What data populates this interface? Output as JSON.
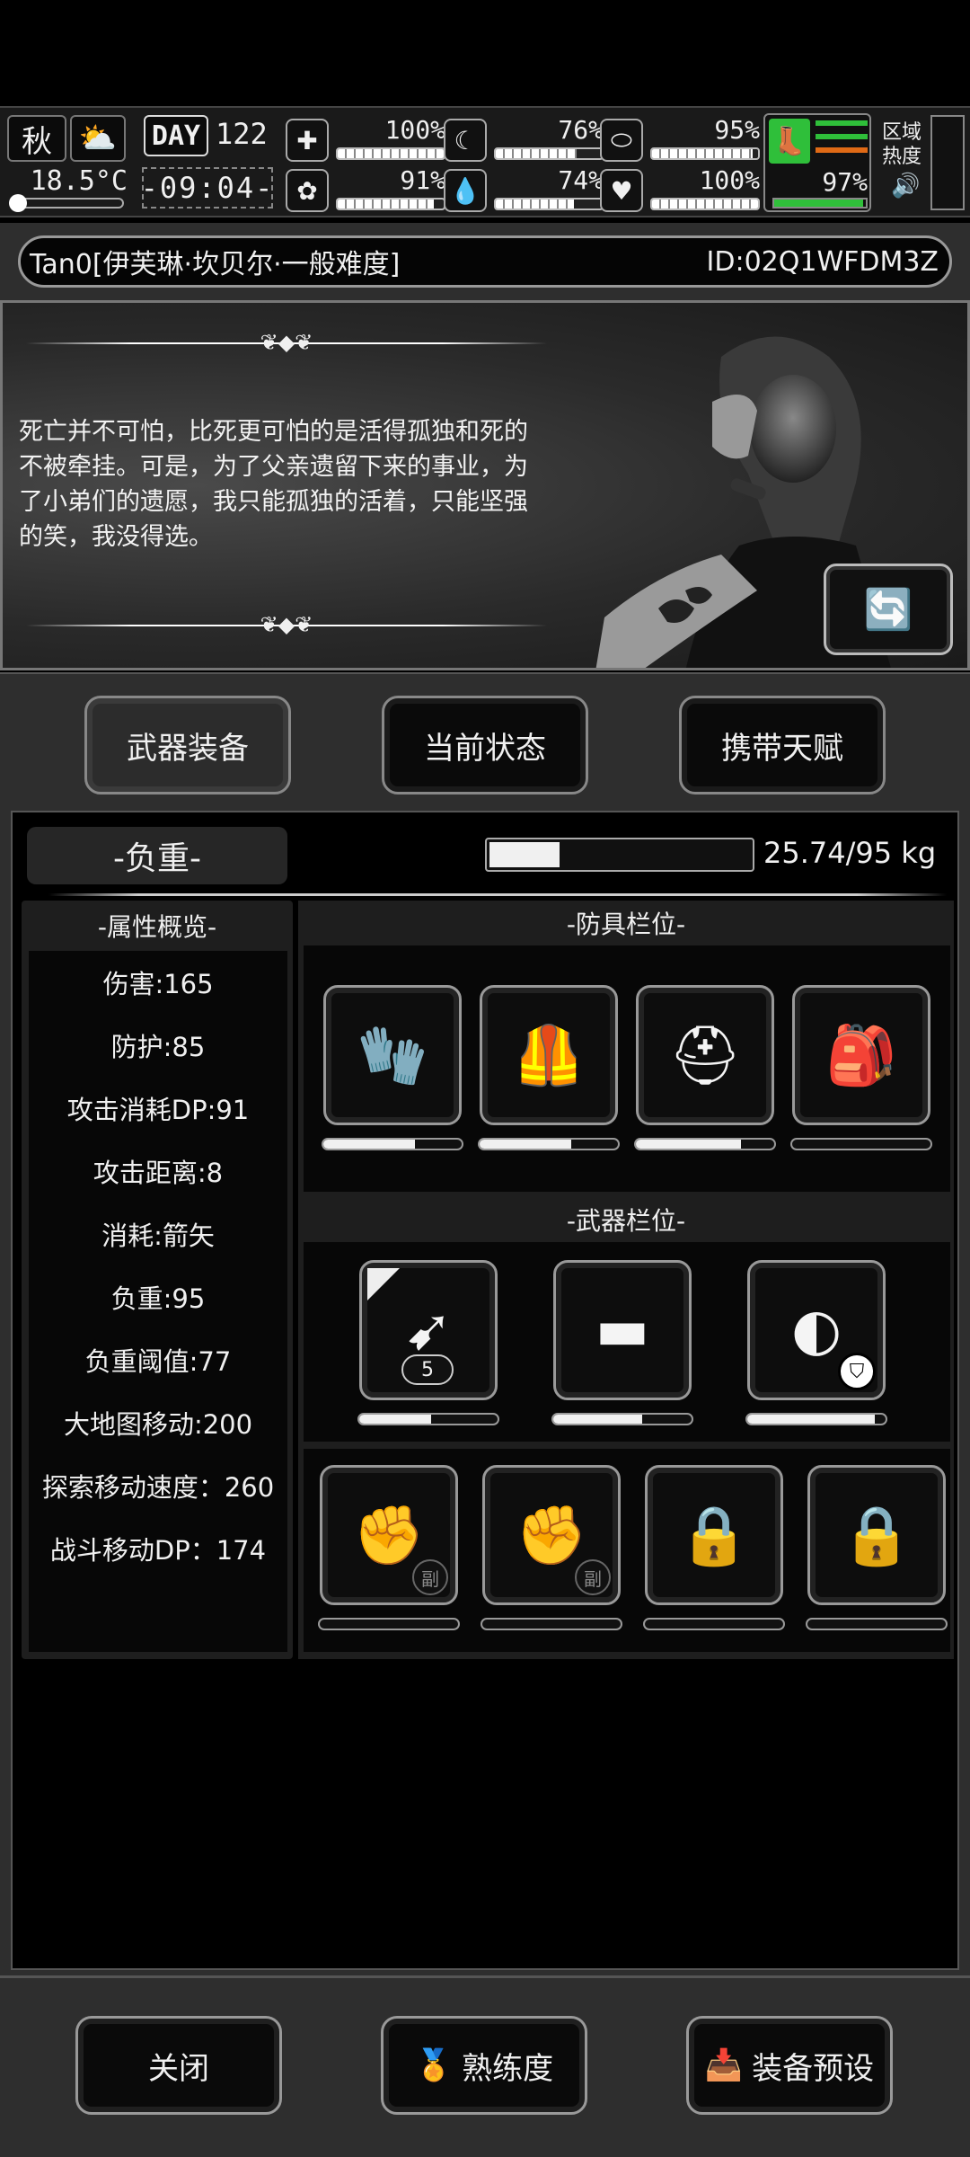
{
  "hud": {
    "season": "秋",
    "weather_icon": "partly-cloudy-icon",
    "temperature": "18.5°C",
    "day_label": "DAY",
    "day_number": "122",
    "clock": "-09:04-",
    "stats": [
      {
        "icon": "medkit-icon",
        "glyph": "✚",
        "value": "100%",
        "fraction": 1.0
      },
      {
        "icon": "stomach-icon",
        "glyph": "☾",
        "value": "76%",
        "fraction": 0.76
      },
      {
        "icon": "pill-icon",
        "glyph": "⬭",
        "value": "95%",
        "fraction": 0.95
      },
      {
        "icon": "brain-icon",
        "glyph": "✿",
        "value": "91%",
        "fraction": 0.91
      },
      {
        "icon": "water-drop-icon",
        "glyph": "💧",
        "value": "74%",
        "fraction": 0.74
      },
      {
        "icon": "heart-icon",
        "glyph": "♥",
        "value": "100%",
        "fraction": 1.0
      }
    ],
    "stamina_value": "97%",
    "stamina_fraction": 0.97,
    "area_heat_label": "区域热度",
    "accent_green": "#2fbf3a",
    "accent_orange": "#e06a16"
  },
  "character": {
    "name_line": "Tan0[伊芙琳·坎贝尔·一般难度]",
    "id_line": "ID:02Q1WFDM3Z",
    "quote": "死亡并不可怕，比死更可怕的是活得孤独和死的不被牵挂。可是，为了父亲遗留下来的事业，为了小弟们的遗愿，我只能孤独的活着，只能坚强的笑，我没得选。"
  },
  "tabs": [
    "武器装备",
    "当前状态",
    "携带天赋"
  ],
  "load": {
    "title": "-负重-",
    "value": "25.74/95 kg",
    "fraction": 0.27
  },
  "attributes": {
    "title": "-属性概览-",
    "items": [
      "伤害:165",
      "防护:85",
      "攻击消耗DP:91",
      "攻击距离:8",
      "消耗:箭矢",
      "负重:95",
      "负重阈值:77",
      "大地图移动:200",
      "探索移动速度：260",
      "战斗移动DP：174"
    ]
  },
  "armor": {
    "title": "-防具栏位-",
    "slots": [
      {
        "icon": "gloves-icon",
        "glyph": "🧤",
        "durability": 0.66
      },
      {
        "icon": "tactical-vest-icon",
        "glyph": "🦺",
        "durability": 0.66
      },
      {
        "icon": "helmet-icon",
        "glyph": "⛑",
        "durability": 0.76
      },
      {
        "icon": "backpack-icon",
        "glyph": "🎒",
        "durability": 0.0
      }
    ]
  },
  "weapons": {
    "title": "-武器栏位-",
    "slots": [
      {
        "icon": "crossbow-icon",
        "glyph": "➹",
        "durability": 0.52,
        "ammo": "5"
      },
      {
        "icon": "assault-rifle-icon",
        "glyph": "▬",
        "durability": 0.64
      },
      {
        "icon": "shield-icon",
        "glyph": "◐",
        "durability": 0.92
      }
    ],
    "secondary_label": "副",
    "secondary_slots": [
      {
        "icon": "fist-icon",
        "badge": "副",
        "locked": false
      },
      {
        "icon": "fist-icon",
        "badge": "副",
        "locked": false
      },
      {
        "icon": "fist-lock-icon",
        "badge": "",
        "locked": true
      },
      {
        "icon": "fist-lock-icon",
        "badge": "",
        "locked": true
      }
    ]
  },
  "bottom": {
    "close": "关闭",
    "proficiency": "熟练度",
    "preset": "装备预设"
  }
}
